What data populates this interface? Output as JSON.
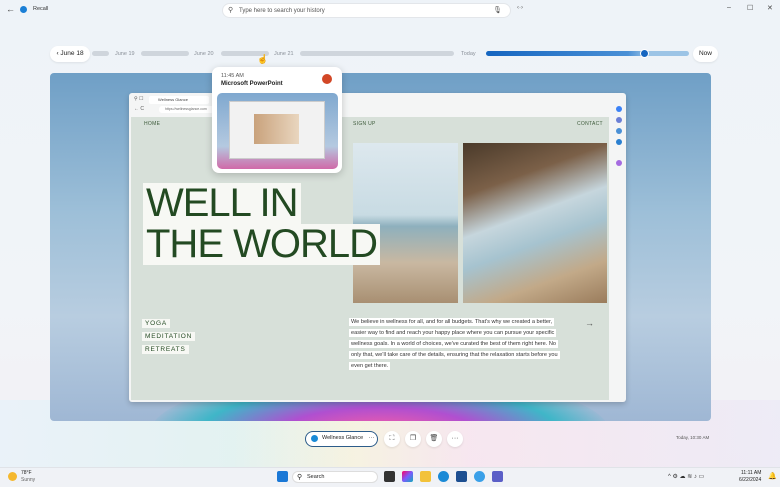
{
  "app": {
    "title": "Recall",
    "search_placeholder": "Type here to search your history"
  },
  "window_controls": {
    "minimize": "–",
    "maximize": "☐",
    "close": "✕"
  },
  "timeline": {
    "start": "June 18",
    "labels": [
      "June 19",
      "June 20",
      "June 21",
      "Today"
    ],
    "end": "Now",
    "position_percent": 85
  },
  "popup": {
    "time": "11:45 AM",
    "app": "Microsoft PowerPoint"
  },
  "browser": {
    "tab": "Wellness Glance",
    "url": "https://wellnessglance.com"
  },
  "site": {
    "nav": [
      "HOME",
      "SIGN UP",
      "CONTACT"
    ],
    "headline": [
      "WELL IN",
      "THE WORLD"
    ],
    "tags": [
      "YOGA",
      "MEDITATION",
      "RETREATS"
    ],
    "paragraph": "We believe in wellness for all, and for all budgets. That's why we created a better, easier way to find and reach your happy place where you can pursue your specific wellness goals. In a world of choices, we've curated the best of them right here. No only that, we'll take care of the details, ensuring that the relaxation starts before you even get there.",
    "arrow": "→"
  },
  "snapshot_bar": {
    "app_label": "Wellness Glance",
    "more": "···",
    "timestamp": "Today, 10:30 AM"
  },
  "taskbar": {
    "weather_temp": "78°F",
    "weather_text": "Sunny",
    "search": "Search",
    "time": "11:11 AM",
    "date": "6/22/2024"
  },
  "colors": {
    "accent": "#1565c0",
    "headline": "#234a22",
    "page_bg": "#d7e0d9"
  }
}
